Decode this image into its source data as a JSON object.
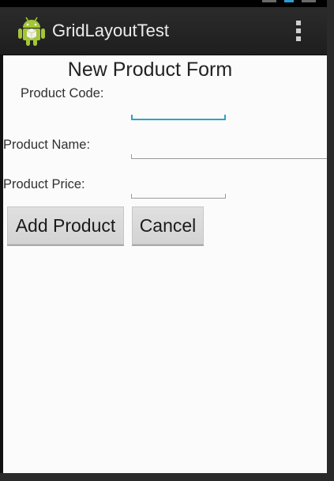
{
  "app": {
    "title": "GridLayoutTest",
    "icon": "android-robot-icon",
    "overflow_icon": "overflow-menu-icon"
  },
  "form": {
    "title": "New Product Form",
    "product_code_label": "Product Code:",
    "product_code_value": "",
    "product_name_label": "Product Name:",
    "product_name_value": "",
    "product_price_label": "Product Price:",
    "product_price_value": "",
    "add_button_label": "Add Product",
    "cancel_button_label": "Cancel"
  },
  "colors": {
    "focus_accent": "#2aa3c7",
    "action_bar": "#222222",
    "android_green": "#a4c639"
  }
}
